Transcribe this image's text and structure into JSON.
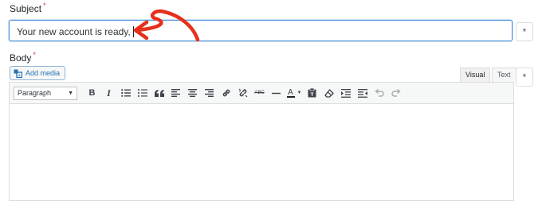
{
  "subject": {
    "label": "Subject",
    "required_mark": "*",
    "value": "Your new account is ready,"
  },
  "body": {
    "label": "Body",
    "required_mark": "*"
  },
  "side_button_glyph": "*",
  "media": {
    "add_media_label": "Add media",
    "icon": "add-media-icon"
  },
  "editor_tabs": {
    "visual": "Visual",
    "text": "Text"
  },
  "toolbar": {
    "format_select_value": "Paragraph",
    "buttons": [
      "bold",
      "italic",
      "bullet-list",
      "numbered-list",
      "blockquote",
      "align-left",
      "align-center",
      "align-right",
      "insert-link",
      "remove-link",
      "strikethrough",
      "horizontal-line",
      "text-color",
      "paste-as-text",
      "clear-formatting",
      "indent",
      "outdent",
      "undo",
      "redo"
    ],
    "bold_glyph": "B",
    "italic_glyph": "I",
    "abc_glyph": "ABC",
    "text_color_glyph": "A"
  },
  "annotation": {
    "color": "#e5301b",
    "icon": "red-arrow-annotation"
  },
  "colors": {
    "focus_border": "#4a90d9",
    "link": "#2271b1",
    "required": "#d63638"
  }
}
